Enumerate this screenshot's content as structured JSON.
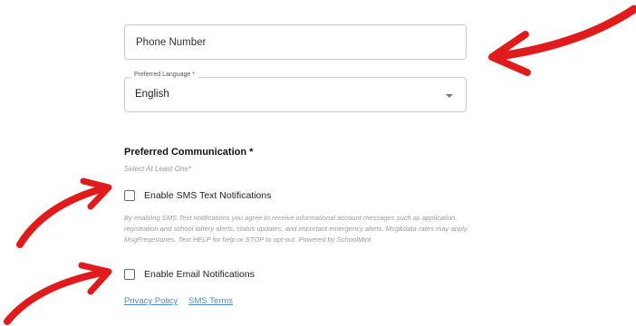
{
  "phone": {
    "placeholder": "Phone Number"
  },
  "language": {
    "legend": "Preferred Language *",
    "value": "English"
  },
  "communication": {
    "title": "Preferred Communication *",
    "hint": "Select At Least One*",
    "sms_label": "Enable SMS Text Notifications",
    "disclaimer": "By enabling SMS Text notifications you agree to receive informational account messages such as application, registration and school lottery alerts, status updates, and important emergency alerts. Msg&data rates may apply. MsgFreqeVaries. Text HELP for help or STOP to opt-out. Powered by SchoolMint.",
    "email_label": "Enable Email Notifications"
  },
  "links": {
    "privacy": "Privacy Policy",
    "sms_terms": "SMS Terms"
  },
  "colors": {
    "arrow": "#e11b1b",
    "link": "#4f8bc6",
    "hint": "#999999"
  }
}
